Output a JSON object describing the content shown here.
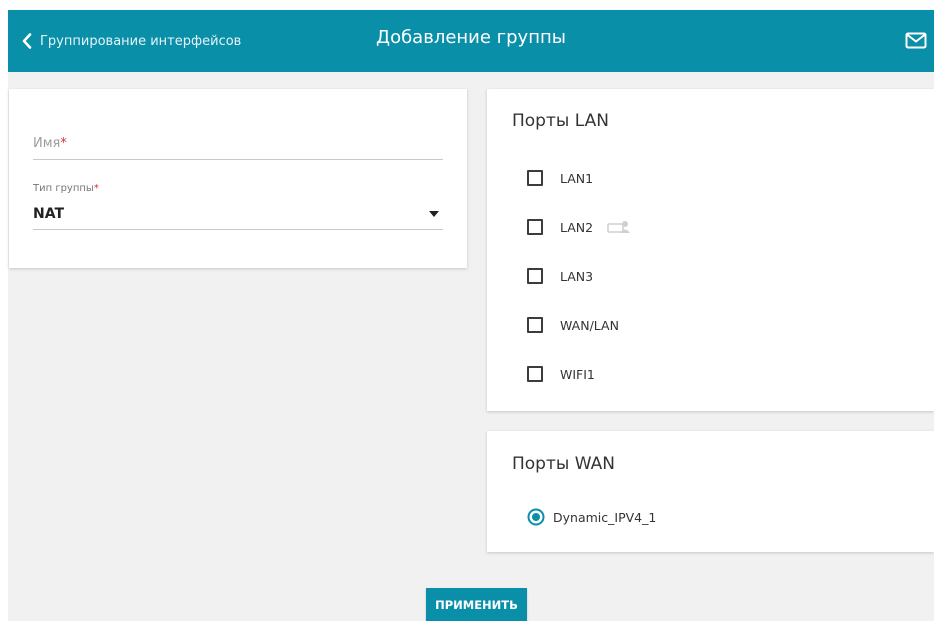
{
  "header": {
    "back_label": "Группирование интерфейсов",
    "title": "Добавление группы",
    "accent_color": "#0a8fa9",
    "icons": {
      "back": "chevron-left-icon",
      "mail": "mail-icon"
    }
  },
  "group_form": {
    "name_placeholder": "Имя",
    "name_value": "",
    "required_mark": "*",
    "type_label": "Тип группы",
    "type_value": "NAT"
  },
  "lan_ports": {
    "title": "Порты LAN",
    "ports": [
      {
        "label": "LAN1",
        "checked": false
      },
      {
        "label": "LAN2",
        "checked": false,
        "icon": "connected-device-icon"
      },
      {
        "label": "LAN3",
        "checked": false
      },
      {
        "label": "WAN/LAN",
        "checked": false
      },
      {
        "label": "WIFI1",
        "checked": false
      }
    ]
  },
  "wan_ports": {
    "title": "Порты WAN",
    "options": [
      {
        "label": "Dynamic_IPV4_1",
        "selected": true
      }
    ]
  },
  "actions": {
    "apply_label": "ПРИМЕНИТЬ"
  }
}
